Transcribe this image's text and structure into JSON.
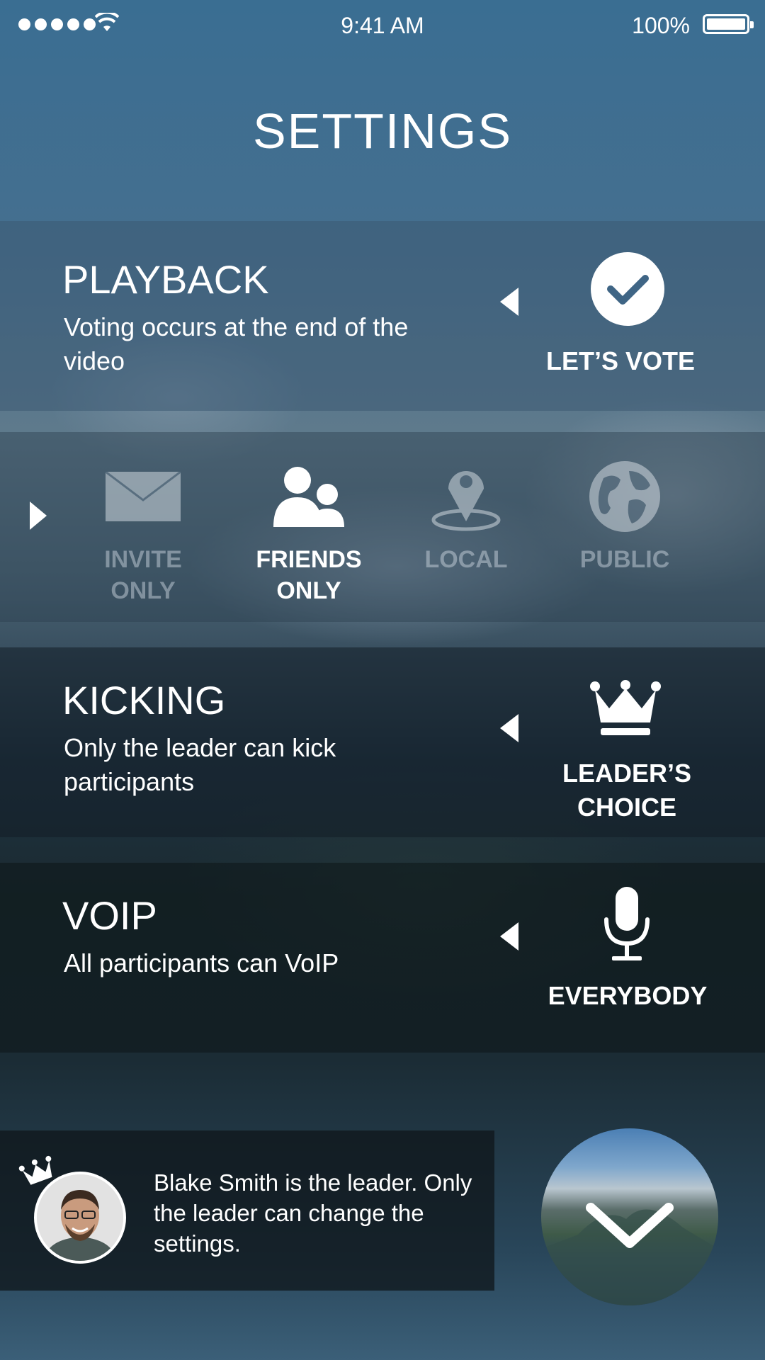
{
  "status_bar": {
    "time": "9:41 AM",
    "battery": "100%"
  },
  "title": "SETTINGS",
  "playback": {
    "title": "PLAYBACK",
    "description": "Voting occurs at the end of the video",
    "option": "LET’S VOTE"
  },
  "visibility": {
    "items": [
      {
        "label": "INVITE ONLY",
        "selected": false
      },
      {
        "label": "FRIENDS ONLY",
        "selected": true
      },
      {
        "label": "LOCAL",
        "selected": false
      },
      {
        "label": "PUBLIC",
        "selected": false
      }
    ]
  },
  "kicking": {
    "title": "KICKING",
    "description": "Only the leader can kick participants",
    "option": "LEADER’S CHOICE"
  },
  "voip": {
    "title": "VOIP",
    "description": "All participants can VoIP",
    "option": "EVERYBODY"
  },
  "leader": {
    "message": "Blake Smith is the leader. Only the leader can change the settings."
  },
  "icons": {
    "playback": "check-circle-icon",
    "invite": "envelope-icon",
    "friends": "people-icon",
    "local": "location-pin-icon",
    "public": "globe-icon",
    "kicking": "crown-icon",
    "voip": "microphone-icon",
    "next": "chevron-down-icon"
  }
}
